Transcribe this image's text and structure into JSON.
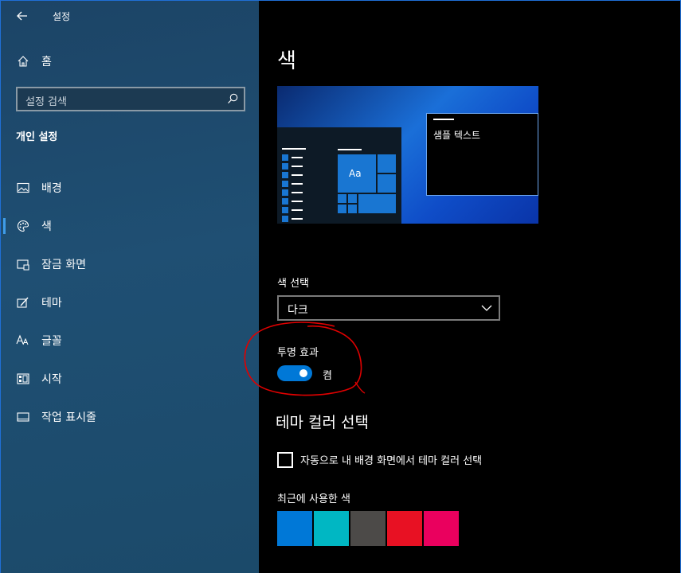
{
  "window": {
    "title": "설정"
  },
  "sidebar": {
    "home_label": "홈",
    "search_placeholder": "설정 검색",
    "section_heading": "개인 설정",
    "items": [
      {
        "label": "배경",
        "icon": "image-icon",
        "active": false
      },
      {
        "label": "색",
        "icon": "palette-icon",
        "active": true
      },
      {
        "label": "잠금 화면",
        "icon": "lock-screen-icon",
        "active": false
      },
      {
        "label": "테마",
        "icon": "theme-brush-icon",
        "active": false
      },
      {
        "label": "글꼴",
        "icon": "font-icon",
        "active": false
      },
      {
        "label": "시작",
        "icon": "start-icon",
        "active": false
      },
      {
        "label": "작업 표시줄",
        "icon": "taskbar-icon",
        "active": false
      }
    ]
  },
  "main": {
    "title": "색",
    "preview": {
      "tile_label": "Aa",
      "window_text": "샘플 텍스트"
    },
    "color_choice": {
      "label": "색 선택",
      "value": "다크"
    },
    "transparency": {
      "label": "투명 효과",
      "state": "켬",
      "on": true
    },
    "accent_heading": "테마 컬러 선택",
    "auto_accent": {
      "label": "자동으로 내 배경 화면에서 테마 컬러 선택",
      "checked": false
    },
    "recent_colors": {
      "label": "최근에 사용한 색",
      "colors": [
        "#0078d7",
        "#00b7c3",
        "#4c4a48",
        "#e81123",
        "#ea005e"
      ]
    }
  },
  "colors": {
    "accent": "#0078d7",
    "annotation": "#e00000",
    "sidebar_bg": "#1f4f73"
  }
}
